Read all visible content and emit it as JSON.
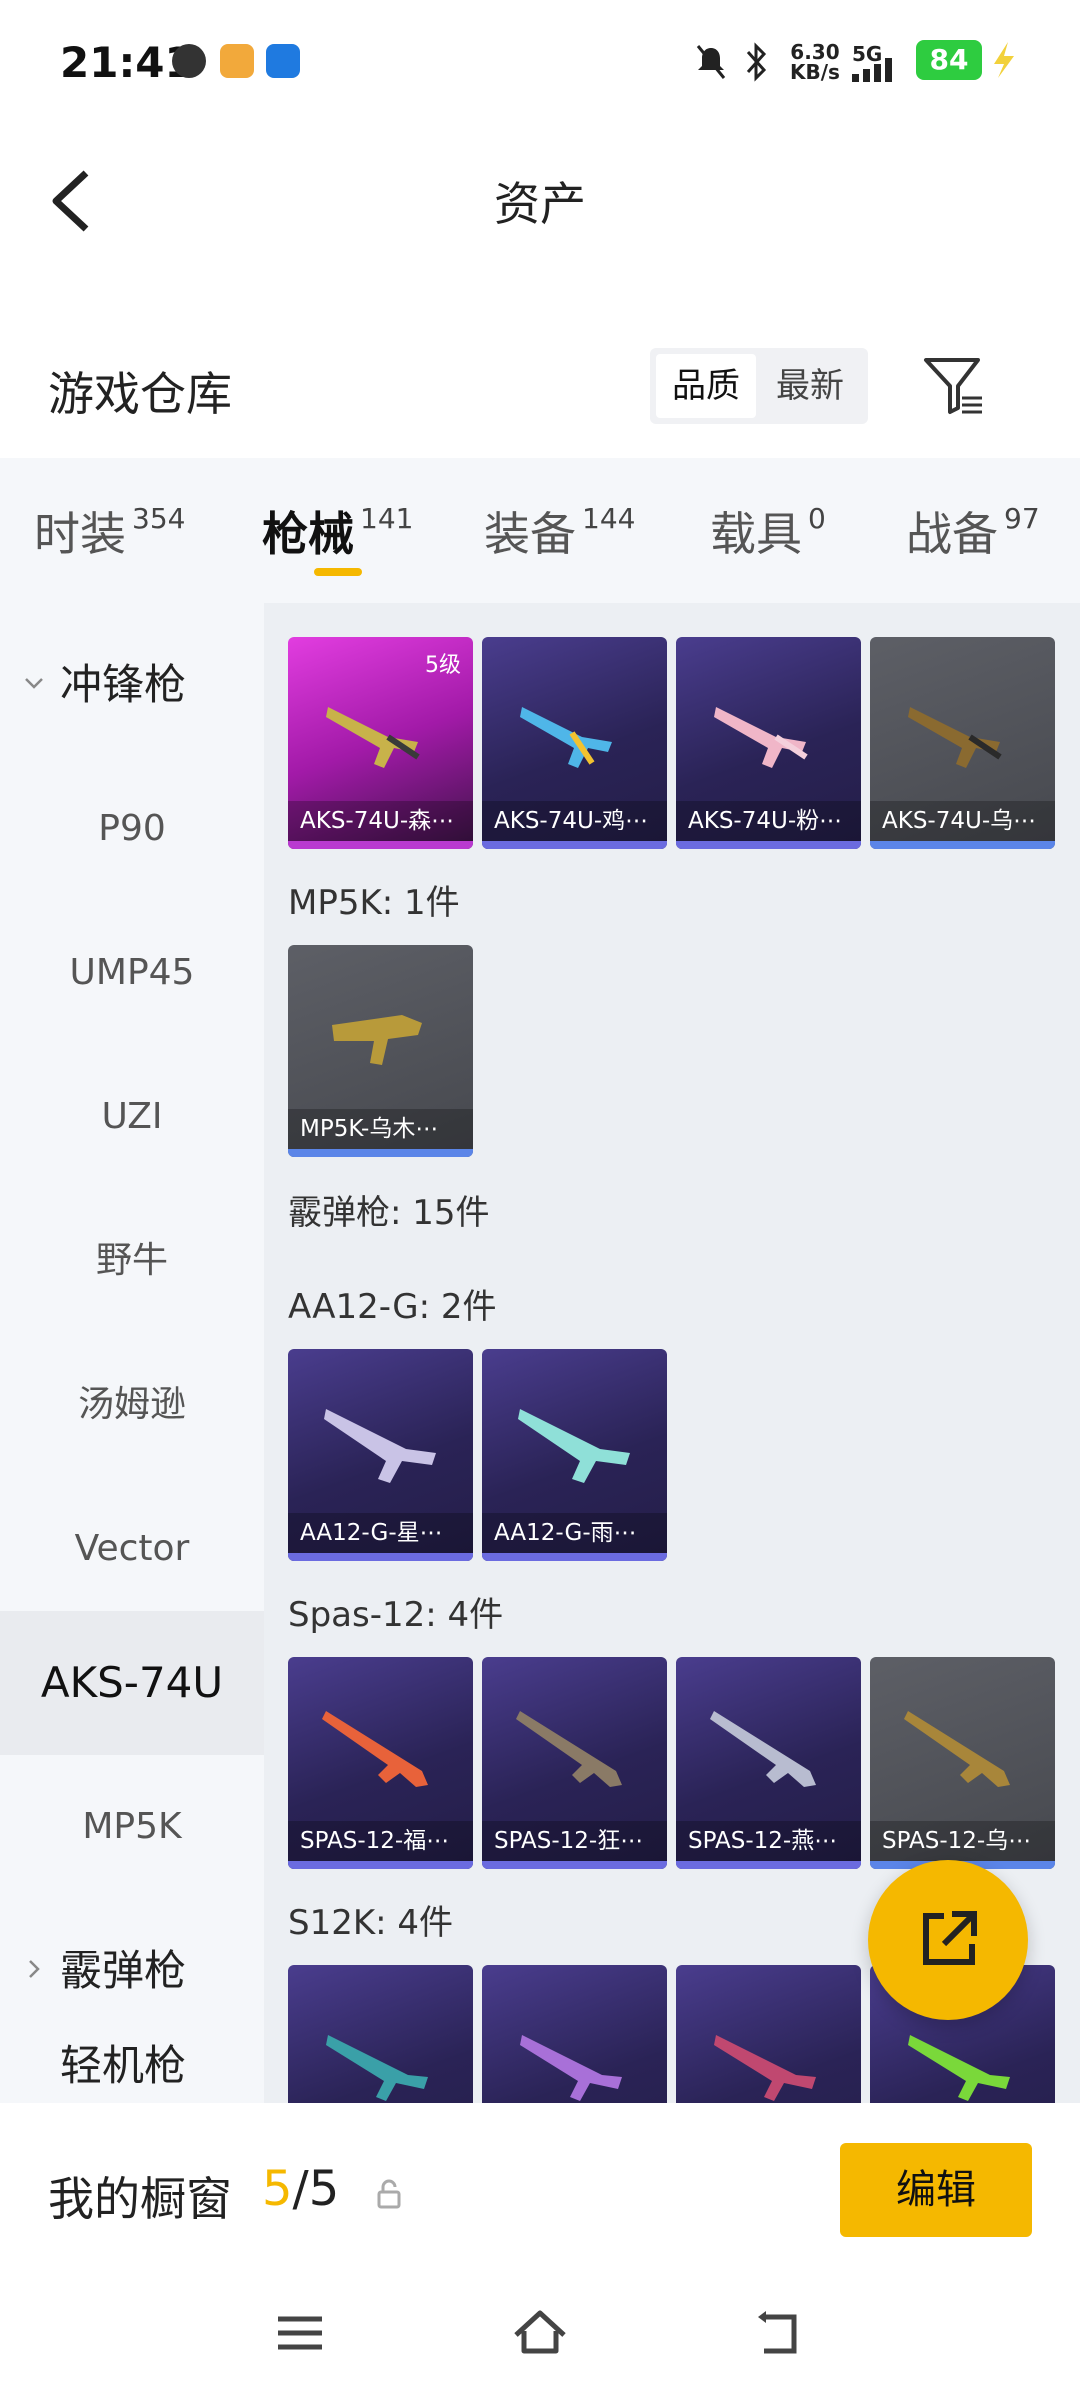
{
  "status": {
    "time": "21:41",
    "speed": "6.30\nKB/s",
    "net": "5G",
    "battery": "84"
  },
  "header": {
    "title": "资产"
  },
  "warehouse": {
    "title": "游戏仓库",
    "sort_options": [
      "品质",
      "最新"
    ]
  },
  "tabs": [
    {
      "label": "时装",
      "count": "354"
    },
    {
      "label": "枪械",
      "count": "141"
    },
    {
      "label": "装备",
      "count": "144"
    },
    {
      "label": "载具",
      "count": "0"
    },
    {
      "label": "战备",
      "count": "97"
    }
  ],
  "sidebar": {
    "group1": "冲锋枪",
    "items": [
      "P90",
      "UMP45",
      "UZI",
      "野牛",
      "汤姆逊",
      "Vector",
      "AKS-74U",
      "MP5K"
    ],
    "group2": "霰弹枪",
    "group3": "轻机枪"
  },
  "content": {
    "row1": [
      {
        "name": "AKS-74U-森⋯",
        "level": "5级"
      },
      {
        "name": "AKS-74U-鸡⋯"
      },
      {
        "name": "AKS-74U-粉⋯"
      },
      {
        "name": "AKS-74U-乌⋯"
      }
    ],
    "mp5k_label": "MP5K: 1件",
    "mp5k": [
      {
        "name": "MP5K-乌木⋯"
      }
    ],
    "shotgun_label": "霰弹枪: 15件",
    "aa12_label": "AA12-G: 2件",
    "aa12": [
      {
        "name": "AA12-G-星⋯"
      },
      {
        "name": "AA12-G-雨⋯"
      }
    ],
    "spas_label": "Spas-12: 4件",
    "spas": [
      {
        "name": "SPAS-12-福⋯"
      },
      {
        "name": "SPAS-12-狂⋯"
      },
      {
        "name": "SPAS-12-燕⋯"
      },
      {
        "name": "SPAS-12-乌⋯"
      }
    ],
    "s12k_label": "S12K: 4件"
  },
  "bottom": {
    "label": "我的橱窗",
    "count_now": "5",
    "count_total": "/5",
    "edit": "编辑"
  },
  "colors": {
    "accent": "#f5b800",
    "purple": "#2a2356",
    "pink": "#e23de0",
    "grey": "#55575d"
  }
}
